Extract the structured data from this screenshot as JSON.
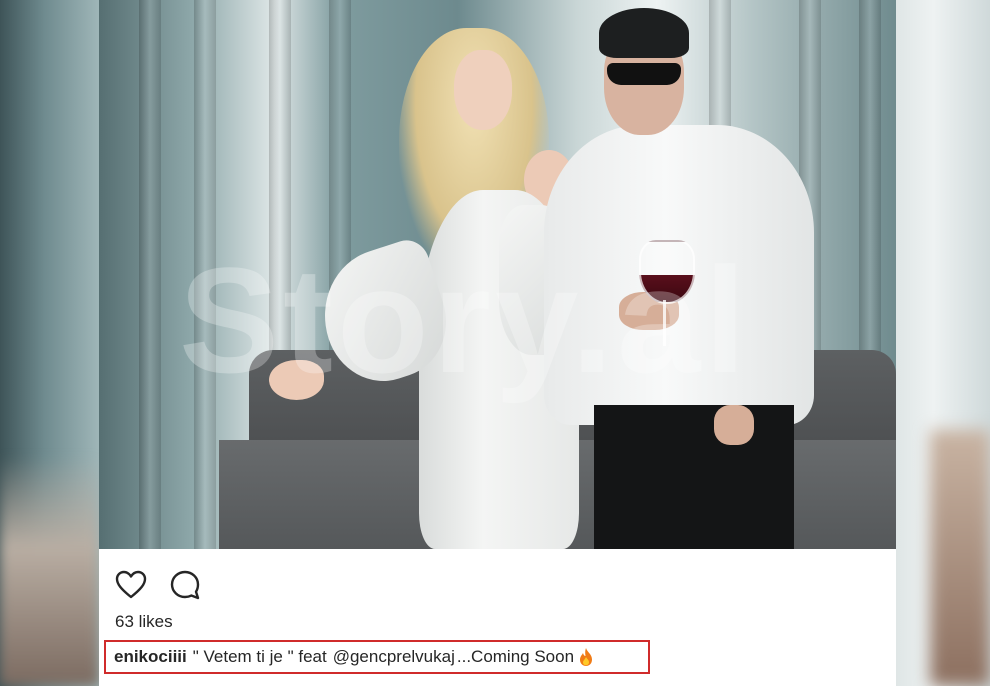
{
  "post": {
    "watermark": "Story.al",
    "likes": "63 likes",
    "caption": {
      "username": "enikociiii",
      "text": "\" Vetem ti je \" feat",
      "mention": "@gencprelvukaj",
      "tail": "...Coming Soon",
      "emoji_icon": "fire-icon"
    },
    "action_icons": [
      "heart-icon",
      "comment-icon"
    ]
  },
  "colors": {
    "highlight_border": "#d02b2b",
    "text": "#262626",
    "panel_bg": "#ffffff"
  }
}
